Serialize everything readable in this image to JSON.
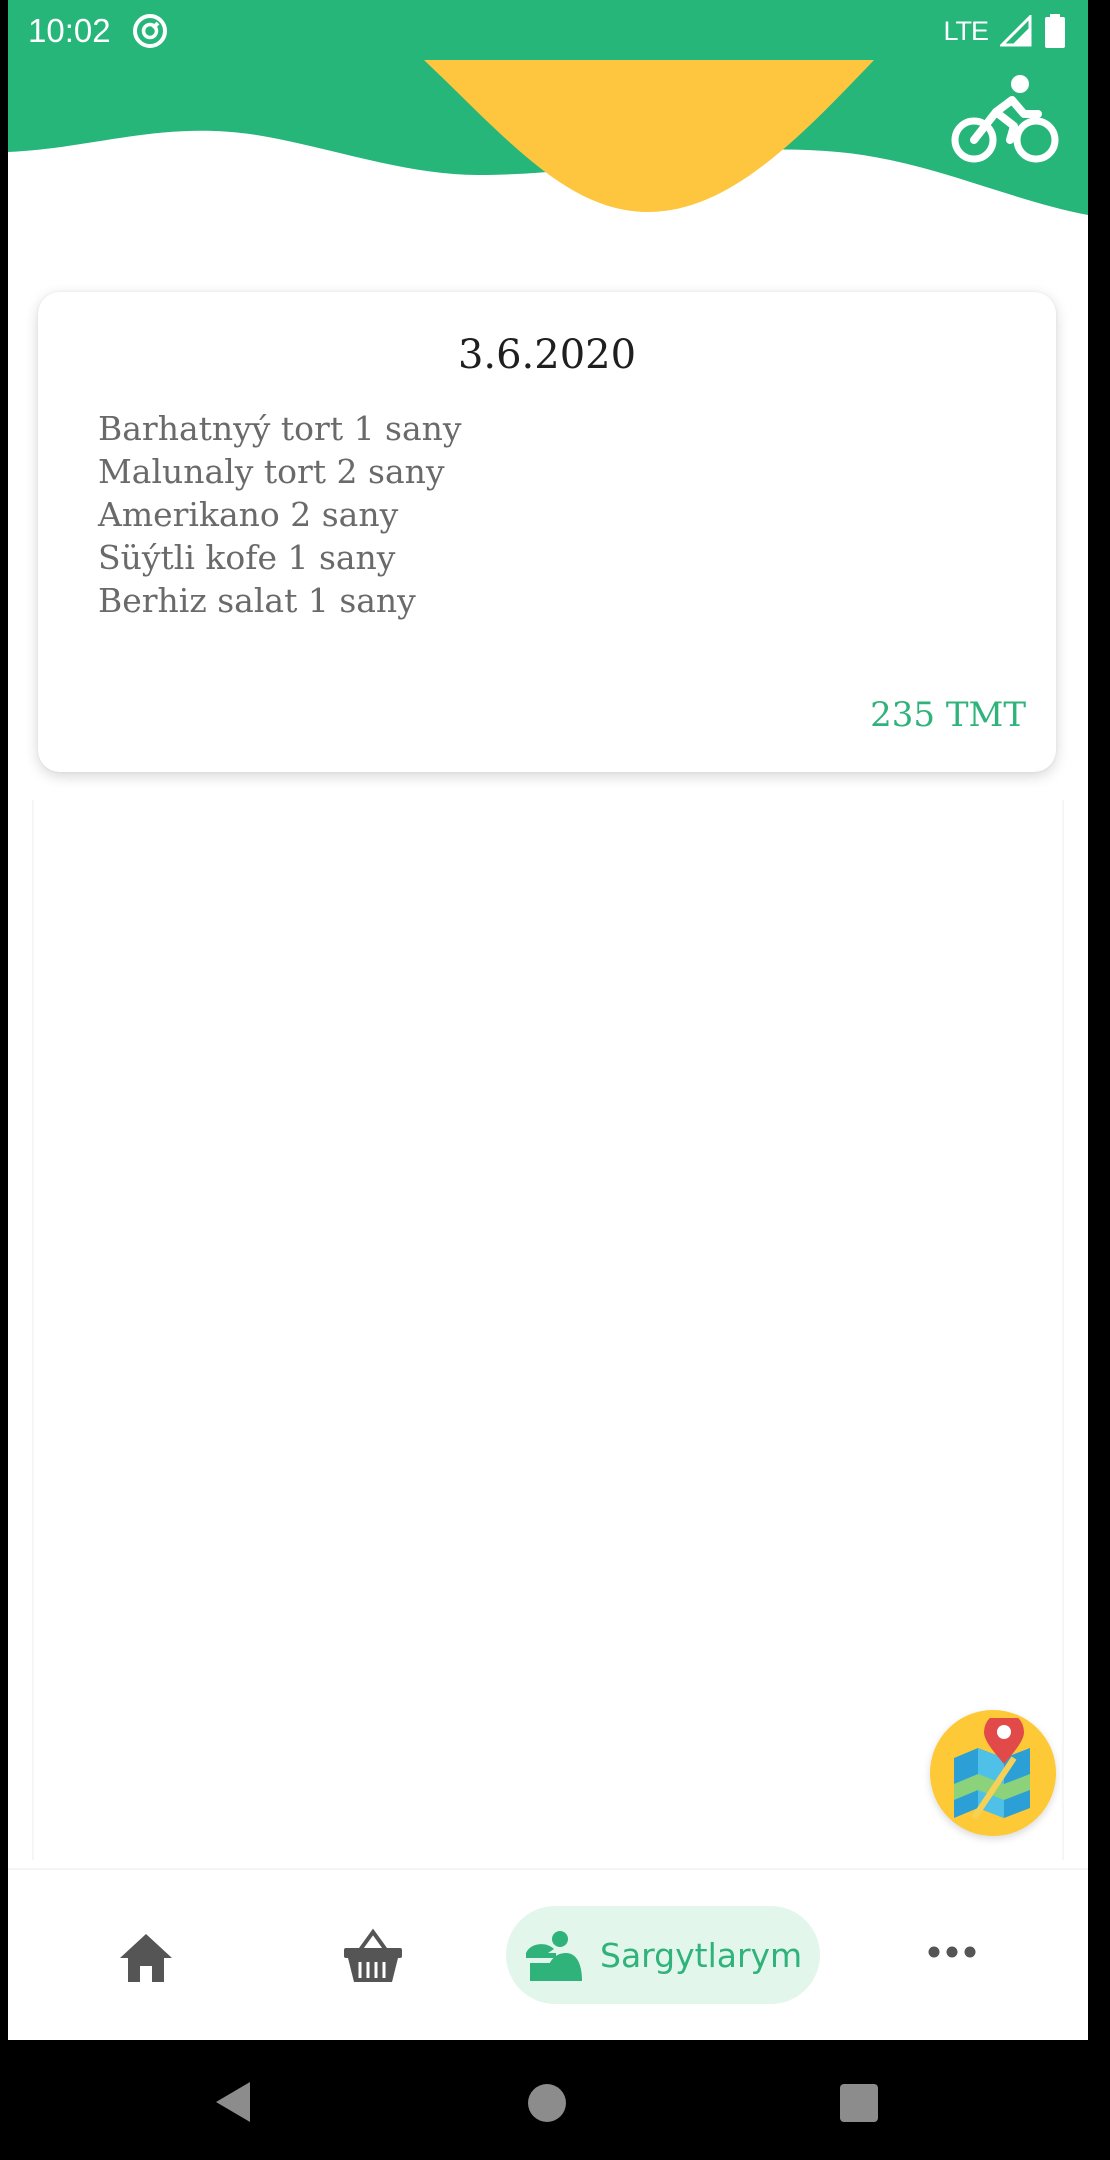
{
  "status_bar": {
    "time": "10:02",
    "network": "LTE"
  },
  "order": {
    "date": "3.6.2020",
    "items": [
      "Barhatnyý tort 1 sany",
      "Malunaly tort 2 sany",
      "Amerikano 2 sany",
      "Süýtli kofe 1 sany",
      "Berhiz salat 1 sany"
    ],
    "total": "235 TMT"
  },
  "bottom_nav": {
    "items": [
      {
        "icon": "home-icon",
        "label": ""
      },
      {
        "icon": "basket-icon",
        "label": ""
      },
      {
        "icon": "orders-icon",
        "label": "Sargytlarym",
        "active": true
      },
      {
        "icon": "more-icon",
        "label": ""
      }
    ]
  },
  "colors": {
    "primary_green": "#26b679",
    "accent_yellow": "#fec63f",
    "active_tab_bg": "#e3f6ec",
    "total_text": "#2fb37a"
  }
}
